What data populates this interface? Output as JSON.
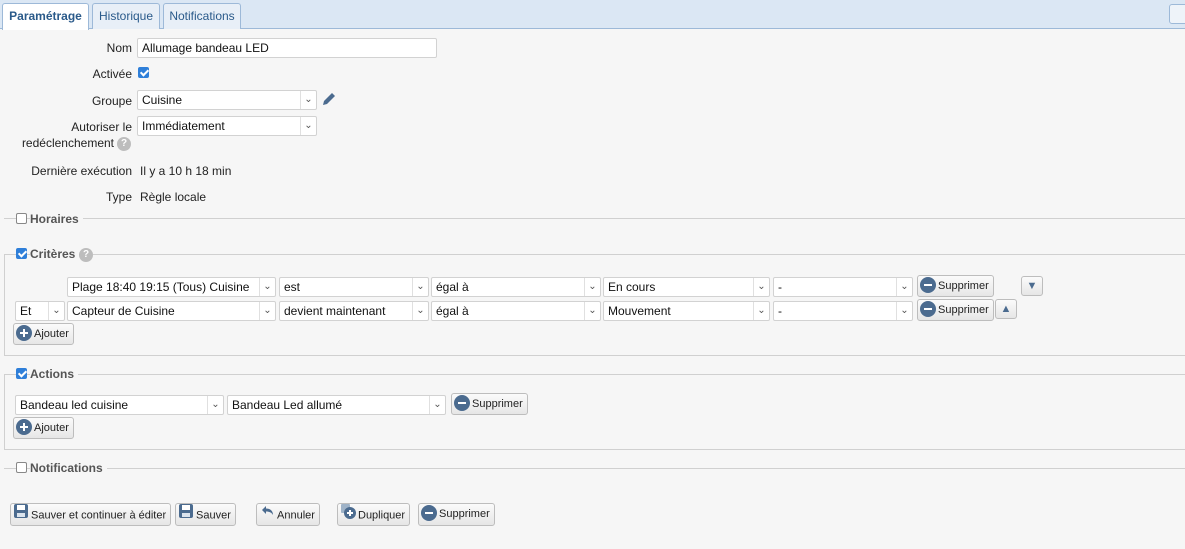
{
  "tabs": [
    {
      "label": "Paramétrage",
      "active": true
    },
    {
      "label": "Historique",
      "active": false
    },
    {
      "label": "Notifications",
      "active": false
    }
  ],
  "form": {
    "name_label": "Nom",
    "name_value": "Allumage bandeau LED",
    "active_label": "Activée",
    "active_checked": true,
    "group_label": "Groupe",
    "group_value": "Cuisine",
    "retrigger_label_1": "Autoriser le",
    "retrigger_label_2": "redéclenchement",
    "retrigger_value": "Immédiatement",
    "last_exec_label": "Dernière exécution",
    "last_exec_value": "Il y a 10 h 18 min",
    "type_label": "Type",
    "type_value": "Règle locale"
  },
  "sections": {
    "horaires": {
      "label": "Horaires",
      "checked": false
    },
    "criteres": {
      "label": "Critères",
      "checked": true
    },
    "actions": {
      "label": "Actions",
      "checked": true
    },
    "notifications": {
      "label": "Notifications",
      "checked": false
    }
  },
  "criteria": [
    {
      "conj": "",
      "subject": "Plage 18:40 19:15 (Tous) Cuisine",
      "verb": "est",
      "op": "égal à",
      "value": "En cours",
      "extra": "-",
      "delete": "Supprimer",
      "move": "down"
    },
    {
      "conj": "Et",
      "subject": "Capteur de Cuisine",
      "verb": "devient maintenant",
      "op": "égal à",
      "value": "Mouvement",
      "extra": "-",
      "delete": "Supprimer",
      "move": "up"
    }
  ],
  "actions": [
    {
      "device": "Bandeau led cuisine",
      "scene": "Bandeau Led allumé",
      "delete": "Supprimer"
    }
  ],
  "add_label": "Ajouter",
  "footer": {
    "save_continue": "Sauver et continuer à éditer",
    "save": "Sauver",
    "cancel": "Annuler",
    "duplicate": "Dupliquer",
    "delete": "Supprimer"
  },
  "colors": {
    "accent": "#2f7fd9",
    "tab_text": "#2a5a8a",
    "icon": "#4b6b8f"
  }
}
